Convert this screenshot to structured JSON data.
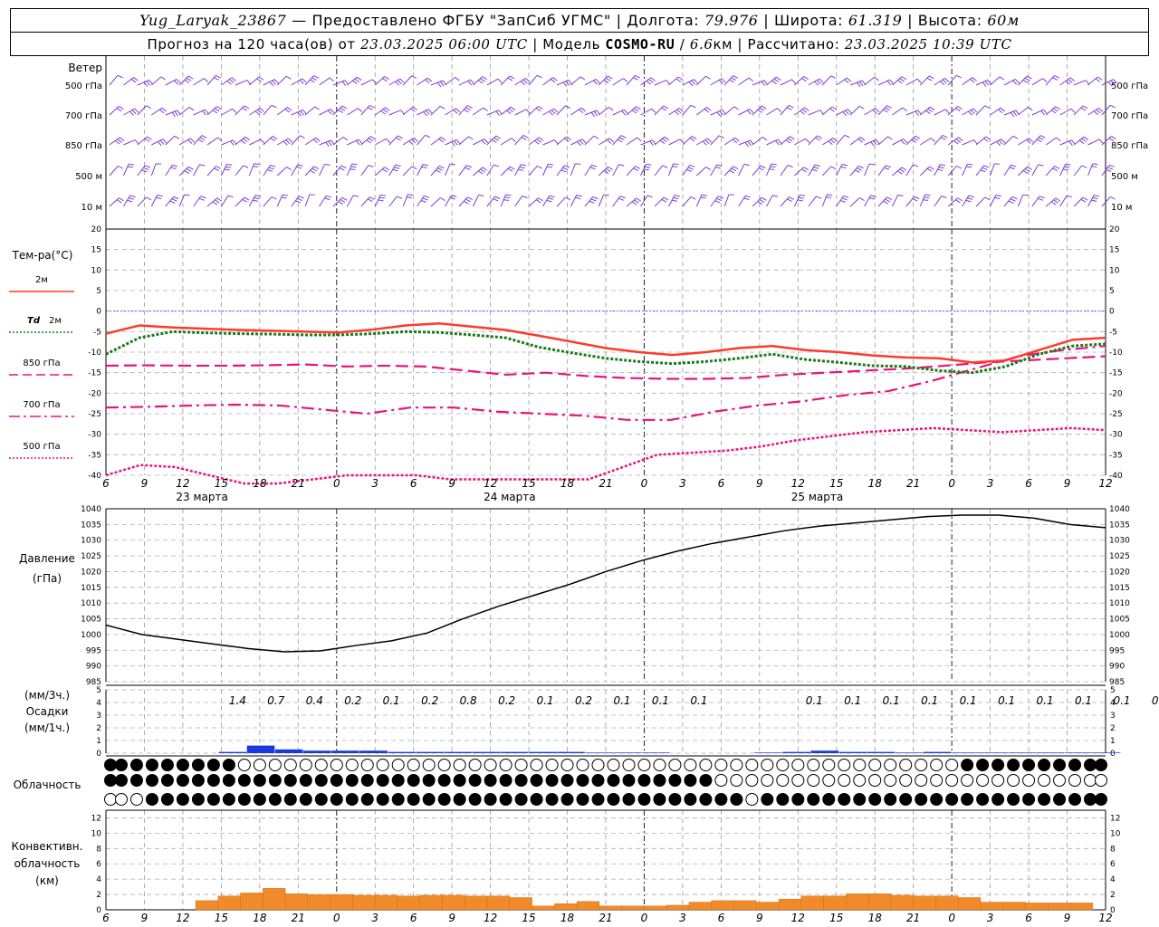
{
  "header": {
    "station": "Yug_Laryak_23867",
    "provided": "— Предоставлено ФГБУ \"ЗапСиб УГМС\"",
    "lon_label": "Долгота:",
    "lon": "79.976",
    "lat_label": "Широта:",
    "lat": "61.319",
    "alt_label": "Высота:",
    "alt": "60м",
    "forecast_label": "Прогноз на 120 часа(ов) от",
    "forecast_from": "23.03.2025 06:00 UTC",
    "model_label": "Модель",
    "model": "COSMO-RU",
    "model_res": "6.6",
    "model_res_unit": "км",
    "calc_label": "Рассчитано:",
    "calc_time": "23.03.2025 10:39 UTC"
  },
  "time_axis": {
    "hour_ticks": [
      "6",
      "9",
      "12",
      "15",
      "18",
      "21",
      "0",
      "3",
      "6",
      "9",
      "12",
      "15",
      "18",
      "21",
      "0",
      "3",
      "6",
      "9",
      "12",
      "15",
      "18",
      "21",
      "0",
      "3",
      "6",
      "9",
      "12"
    ],
    "day_labels": [
      "23 марта",
      "24 марта",
      "25 марта"
    ]
  },
  "wind": {
    "title": "Ветер",
    "levels": [
      "500 гПа",
      "700 гПа",
      "850 гПа",
      "500 м",
      "10 м"
    ],
    "color": "#7f3fd0"
  },
  "temperature": {
    "title": "Тем-ра(°C)",
    "legend": [
      {
        "label": "2м",
        "prefix": "",
        "color": "#ff3a2a",
        "dash": "solid"
      },
      {
        "label": "2м",
        "prefix": "Td",
        "color": "#1a7a1a",
        "dash": "dotted"
      },
      {
        "label": "850 гПа",
        "prefix": "",
        "color": "#e8157a",
        "dash": "dashed"
      },
      {
        "label": "700 гПа",
        "prefix": "",
        "color": "#e8157a",
        "dash": "dashdot"
      },
      {
        "label": "500 гПа",
        "prefix": "",
        "color": "#e8157a",
        "dash": "dotted"
      }
    ],
    "ticks": [
      "20",
      "15",
      "10",
      "5",
      "0",
      "-5",
      "-10",
      "-15",
      "-20",
      "-25",
      "-30",
      "-35",
      "-40"
    ]
  },
  "pressure": {
    "title": "Давление",
    "unit": "(гПа)",
    "ticks": [
      "1040",
      "1035",
      "1030",
      "1025",
      "1020",
      "1015",
      "1010",
      "1005",
      "1000",
      "995",
      "990",
      "985"
    ]
  },
  "precip": {
    "title_unit3": "(мм/3ч.)",
    "title": "Осадки",
    "title_unit1": "(мм/1ч.)",
    "ticks": [
      "5",
      "4",
      "3",
      "2",
      "1",
      "0"
    ],
    "labels_3h": [
      {
        "h": 9,
        "v": "1.4"
      },
      {
        "h": 12,
        "v": "0.7"
      },
      {
        "h": 15,
        "v": "0.4"
      },
      {
        "h": 18,
        "v": "0.2"
      },
      {
        "h": 21,
        "v": "0.1"
      },
      {
        "h": 24,
        "v": "0.2"
      },
      {
        "h": 27,
        "v": "0.8"
      },
      {
        "h": 30,
        "v": "0.2"
      },
      {
        "h": 33,
        "v": "0.1"
      },
      {
        "h": 36,
        "v": "0.2"
      },
      {
        "h": 39,
        "v": "0.1"
      },
      {
        "h": 42,
        "v": "0.1"
      },
      {
        "h": 45,
        "v": "0.1"
      },
      {
        "h": 54,
        "v": "0.1"
      },
      {
        "h": 57,
        "v": "0.1"
      },
      {
        "h": 60,
        "v": "0.1"
      },
      {
        "h": 63,
        "v": "0.1"
      },
      {
        "h": 66,
        "v": "0.1"
      },
      {
        "h": 69,
        "v": "0.1"
      },
      {
        "h": 72,
        "v": "0.1"
      },
      {
        "h": 75,
        "v": "0.1"
      },
      {
        "h": 78,
        "v": "0.1"
      },
      {
        "h": 81,
        "v": "0.1"
      },
      {
        "h": 84,
        "v": "0.1"
      }
    ],
    "color": "#1a3adf"
  },
  "cloud": {
    "title": "Облачность"
  },
  "convective": {
    "title_lines": [
      "Конвективн.",
      "облачность",
      "(км)"
    ],
    "ticks": [
      "12",
      "10",
      "8",
      "6",
      "4",
      "2",
      "0"
    ],
    "color": "#f08a2a"
  },
  "chart_data": {
    "type": "line",
    "x_unit": "hours since 23.03.2025 06:00 UTC",
    "x": [
      0,
      3,
      6,
      9,
      12,
      15,
      18,
      21,
      24,
      27,
      30,
      33,
      36,
      39,
      42,
      45,
      48,
      51,
      54,
      57,
      60,
      63,
      66,
      69,
      72,
      75,
      78
    ],
    "temp_2m": [
      -5.5,
      -3.5,
      -4,
      -4.3,
      -4.6,
      -4.8,
      -5,
      -5.2,
      -4.5,
      -3.5,
      -3,
      -3.8,
      -4.6,
      -6,
      -7.5,
      -9,
      -10,
      -10.7,
      -10,
      -9,
      -8.5,
      -9.5,
      -10,
      -10.8,
      -11.3,
      -11.5,
      -12.5,
      -12,
      -9.5,
      -7,
      -6.5
    ],
    "temp_td_2m": [
      -10.5,
      -6.5,
      -5,
      -5.3,
      -5.5,
      -5.6,
      -5.8,
      -5.8,
      -5.5,
      -5,
      -5.2,
      -5.8,
      -6.5,
      -8.8,
      -10.2,
      -11.5,
      -12.3,
      -12.8,
      -12.3,
      -11.5,
      -10.5,
      -11.8,
      -12.5,
      -13.3,
      -13.5,
      -14.5,
      -15,
      -13.5,
      -10.5,
      -8.5,
      -8
    ],
    "temp_850": [
      -13.3,
      -13.2,
      -13.3,
      -13.3,
      -13.2,
      -13,
      -13.5,
      -13.3,
      -13.5,
      -14.5,
      -15.5,
      -15,
      -15.8,
      -16.3,
      -16.5,
      -16.5,
      -16.3,
      -15.5,
      -15,
      -14.5,
      -14,
      -13.3,
      -12.5,
      -12,
      -11.5,
      -11
    ],
    "temp_700": [
      -23.5,
      -23.3,
      -23,
      -22.8,
      -23,
      -24,
      -25,
      -23.5,
      -23.5,
      -24.5,
      -25,
      -25.5,
      -26.5,
      -26.5,
      -24.5,
      -23,
      -22,
      -20.5,
      -19.5,
      -17,
      -14,
      -11,
      -9.5,
      -8.5
    ],
    "temp_500": [
      -40,
      -37.5,
      -38,
      -40,
      -42,
      -42,
      -41,
      -40,
      -40,
      -40,
      -41,
      -41,
      -41,
      -41,
      -41,
      -38,
      -35,
      -34.5,
      -34,
      -33,
      -31.5,
      -30.5,
      -29.5,
      -29,
      -28.5,
      -29,
      -29.5,
      -29,
      -28.5,
      -29
    ],
    "pressure": [
      1003,
      1000,
      998.5,
      997,
      995.5,
      994.5,
      994.8,
      996.5,
      998,
      1000.5,
      1005,
      1009,
      1012.5,
      1016,
      1020,
      1023.5,
      1026.5,
      1029,
      1031,
      1033,
      1034.5,
      1035.5,
      1036.5,
      1037.5,
      1038,
      1038,
      1037,
      1035,
      1034
    ],
    "precip_1h": [
      0,
      0,
      0,
      0,
      0.1,
      0.6,
      0.3,
      0.2,
      0.2,
      0.2,
      0.1,
      0.1,
      0.1,
      0.1,
      0.1,
      0.1,
      0.1,
      0.05,
      0.05,
      0.05,
      0,
      0,
      0,
      0.05,
      0.1,
      0.2,
      0.1,
      0.1,
      0.05,
      0.1,
      0.05,
      0.05,
      0.05,
      0.05,
      0.05,
      0.05
    ],
    "convective_cloud_km": [
      0,
      0,
      0,
      0,
      1.2,
      1.8,
      2.2,
      2.8,
      2.1,
      2,
      2,
      1.9,
      1.9,
      1.8,
      1.9,
      1.9,
      1.8,
      1.8,
      1.6,
      0.5,
      0.8,
      1.1,
      0.5,
      0.5,
      0.5,
      0.6,
      1,
      1.2,
      1.2,
      1,
      1.4,
      1.8,
      1.8,
      2.1,
      2.1,
      1.9,
      1.8,
      1.8,
      1.6,
      1,
      1,
      0.9,
      0.9,
      0.9
    ],
    "ylim_temp": [
      -40,
      20
    ],
    "ylim_pressure": [
      985,
      1040
    ],
    "ylim_precip": [
      0,
      5
    ],
    "ylim_convective": [
      0,
      13
    ]
  }
}
